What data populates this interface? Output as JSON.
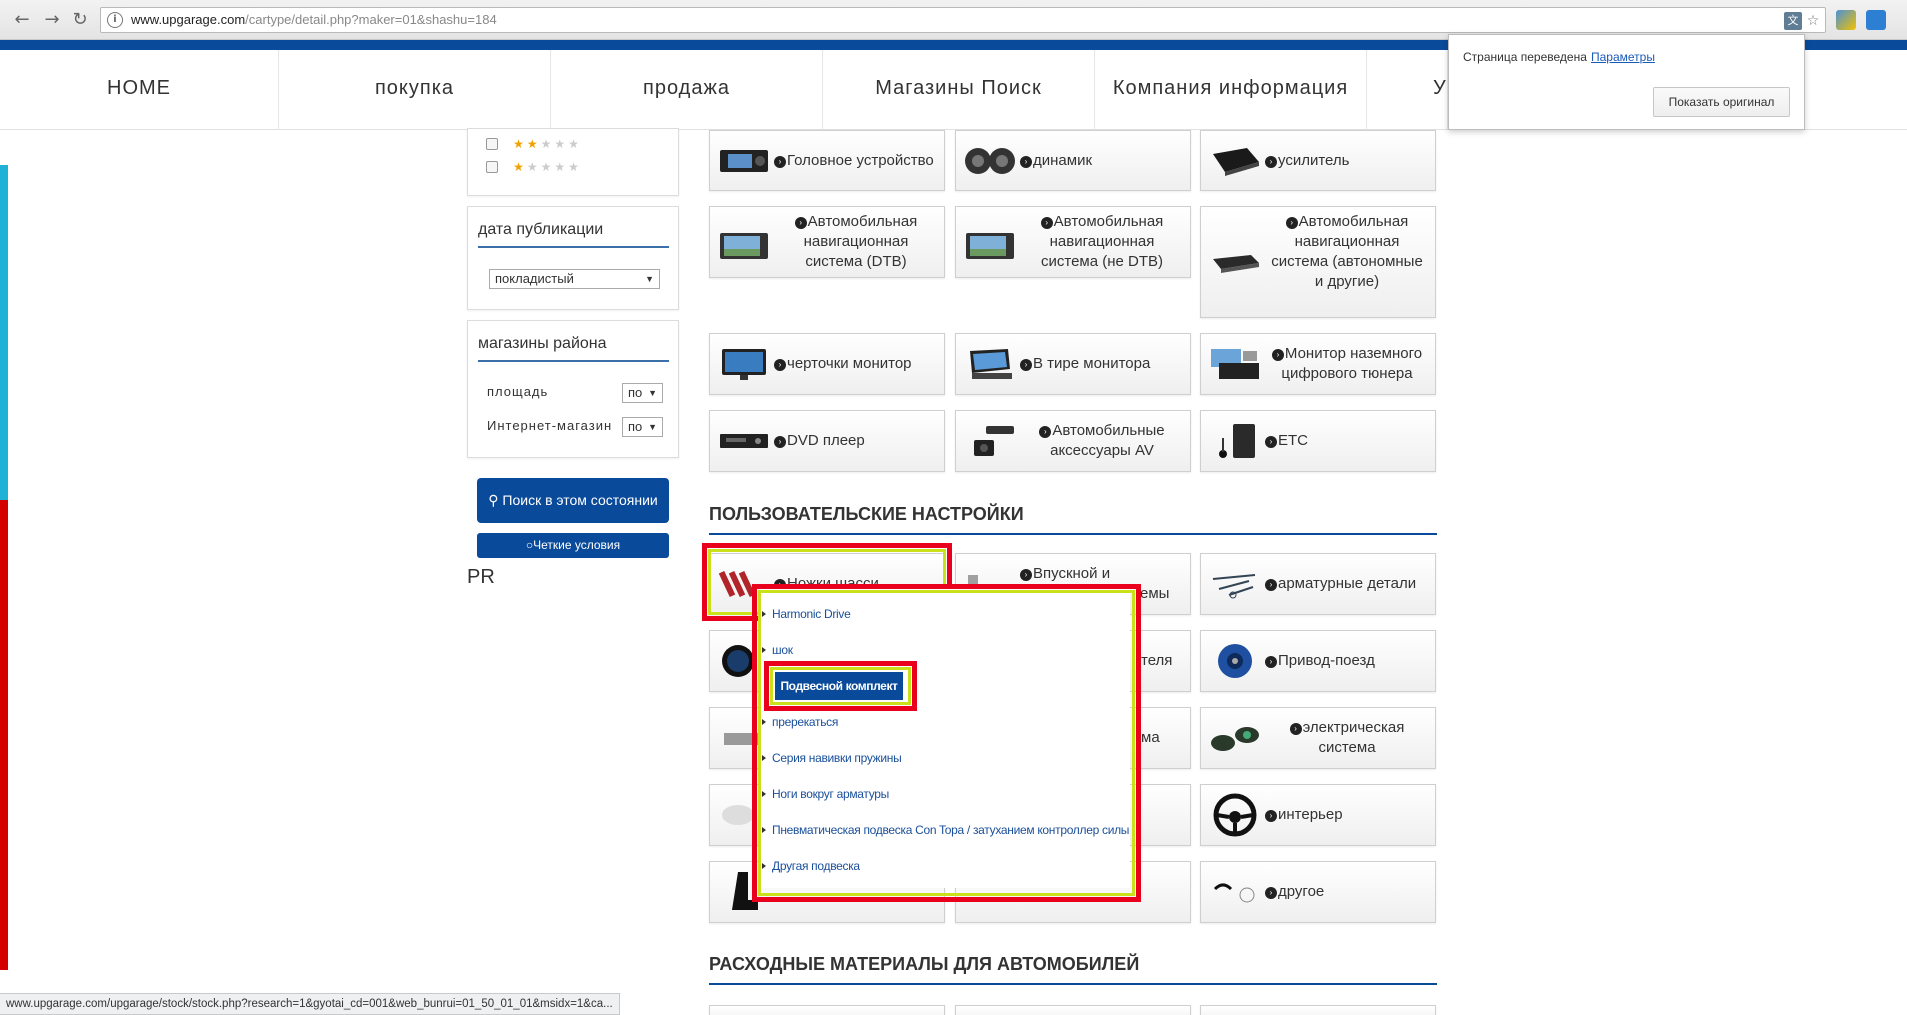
{
  "browser": {
    "url_host": "www.upgarage.com",
    "url_path": "/cartype/detail.php?maker=01&shashu=184",
    "status_url": "www.upgarage.com/upgarage/stock/stock.php?research=1&gyotai_cd=001&web_bunrui=01_50_01_01&msidx=1&ca..."
  },
  "translate_popup": {
    "message": "Страница переведена",
    "options_link": "Параметры",
    "show_original_button": "Показать оригинал"
  },
  "topnav": [
    {
      "label": "HOME"
    },
    {
      "label": "покупка"
    },
    {
      "label": "продажа"
    },
    {
      "label": "Магазины Поиск"
    },
    {
      "label": "Компания информация"
    },
    {
      "label": "Ут"
    }
  ],
  "sidebar": {
    "ratings": [
      {
        "on": "★★",
        "off": "★★★"
      },
      {
        "on": "★",
        "off": "★★★★"
      }
    ],
    "pub_date": {
      "title": "дата публикации",
      "select_value": "покладистый"
    },
    "shops": {
      "title": "магазины района",
      "area_label": "площадь",
      "area_value": "по",
      "online_label": "Интернет-магазин",
      "online_value": "по"
    },
    "search_button": "Поиск в этом состоянии",
    "clear_button": "Четкие условия",
    "pr": "PR"
  },
  "av_tiles": [
    "Головное устройство",
    "динамик",
    "усилитель",
    "Автомобильная навигационная система (DTB)",
    "Автомобильная навигационная система (не DTB)",
    "Автомобильная навигационная система (автономные и другие)",
    "черточки монитор",
    "В тире монитора",
    "Монитор наземного цифрового тюнера",
    "DVD плеер",
    "Автомобильные аксессуары AV",
    "ETC"
  ],
  "custom_section": {
    "title": "ПОЛЬЗОВАТЕЛЬСКИЕ НАСТРОЙКИ",
    "tiles": [
      "Ножки шасси",
      "Впускной и выхлопной системы",
      "арматурные детали",
      "",
      "Детали двигателя",
      "Привод-поезд",
      "",
      "Тормозная система",
      "электрическая система",
      "",
      "",
      "интерьер",
      "",
      "",
      "другое"
    ],
    "tile_fragments": [
      "Впускной и",
      "емы",
      "теля",
      "ма",
      "Ножки шасси"
    ]
  },
  "dropdown": {
    "items": [
      "Harmonic Drive",
      "шок",
      "Подвесной комплект",
      "пререкаться",
      "Серия навивки пружины",
      "Ноги вокруг арматуры",
      "Пневматическая подвеска Con Topa / затуханием контроллер силы",
      "Другая подвеска"
    ]
  },
  "consumables_section": {
    "title": "РАСХОДНЫЕ МАТЕРИАЛЫ ДЛЯ АВТОМОБИЛЕЙ"
  },
  "colors": {
    "brand_blue": "#0a4a9a",
    "highlight_red": "#e8001c",
    "highlight_yellow": "#c9e01a",
    "link_blue": "#1a4f9a"
  }
}
